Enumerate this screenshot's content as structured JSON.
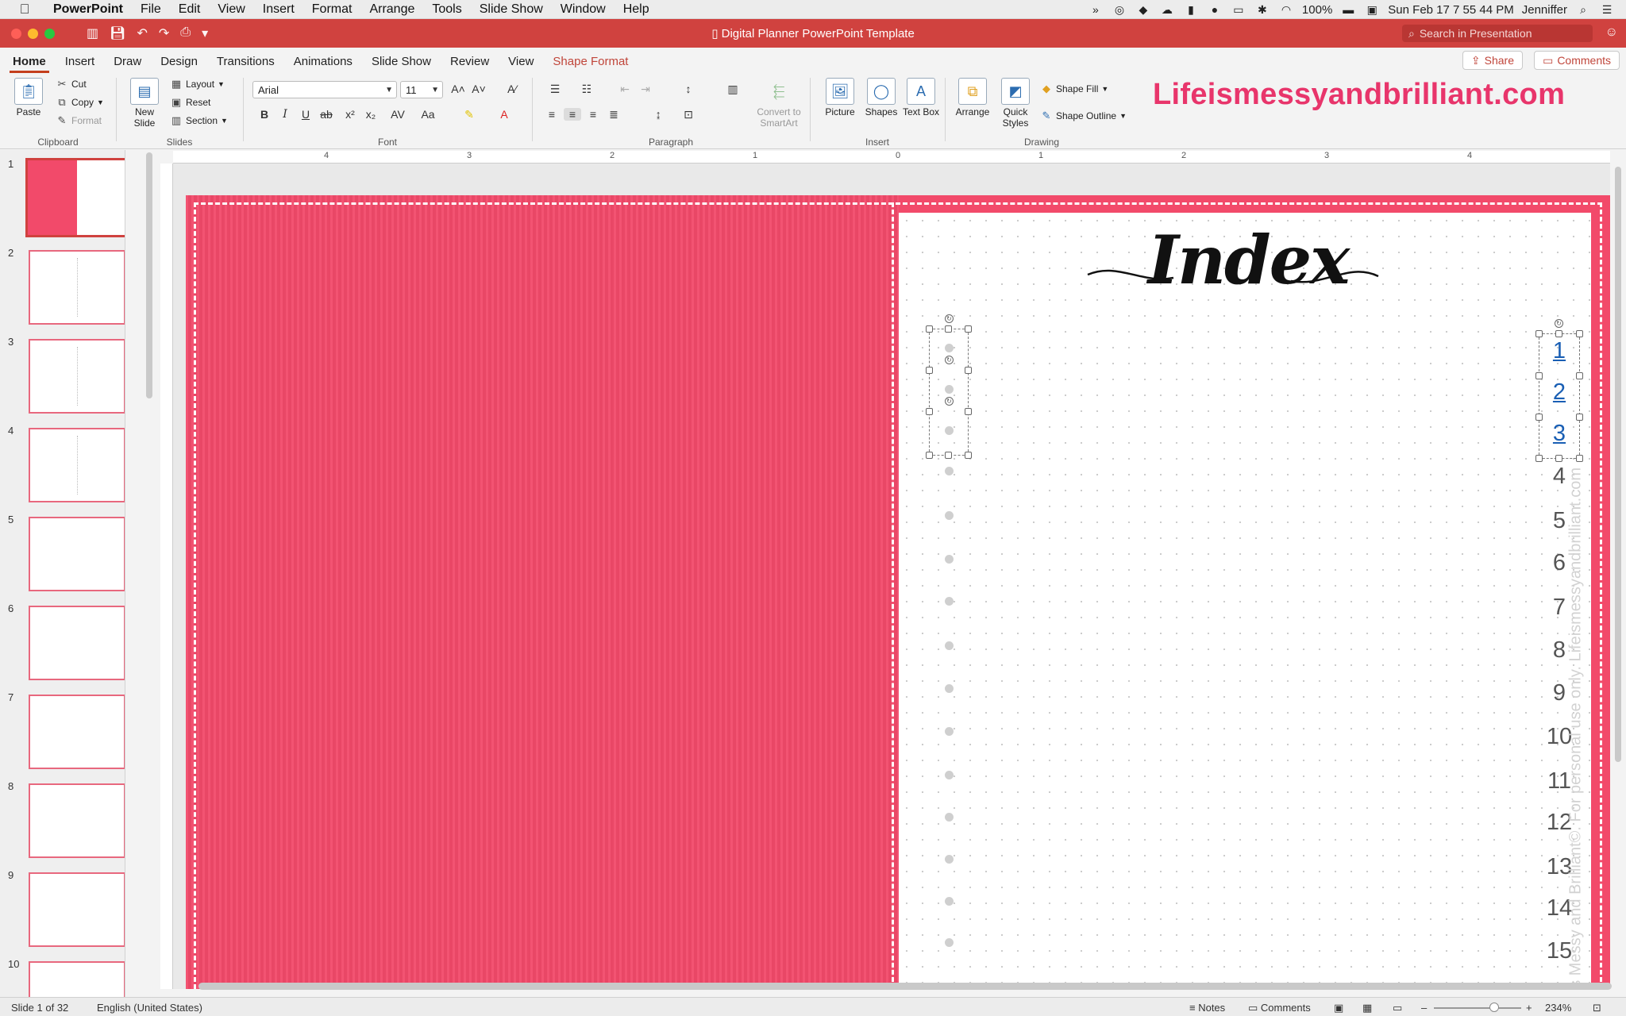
{
  "menubar": {
    "app_name": "PowerPoint",
    "items": [
      "File",
      "Edit",
      "View",
      "Insert",
      "Format",
      "Arrange",
      "Tools",
      "Slide Show",
      "Window",
      "Help"
    ],
    "battery": "100%",
    "datetime": "Sun Feb 17  7 55 44 PM",
    "user": "Jenniffer"
  },
  "window": {
    "title": "Digital Planner PowerPoint Template",
    "search_placeholder": "Search in Presentation"
  },
  "ribbon": {
    "tabs": [
      "Home",
      "Insert",
      "Draw",
      "Design",
      "Transitions",
      "Animations",
      "Slide Show",
      "Review",
      "View",
      "Shape Format"
    ],
    "active_tab": "Home",
    "share_label": "Share",
    "comments_label": "Comments",
    "clipboard": {
      "paste": "Paste",
      "cut": "Cut",
      "copy": "Copy",
      "format": "Format",
      "label": "Clipboard"
    },
    "slides": {
      "new_slide": "New Slide",
      "layout": "Layout",
      "reset": "Reset",
      "section": "Section",
      "label": "Slides"
    },
    "font": {
      "name": "Arial",
      "size": "11",
      "label": "Font"
    },
    "paragraph": {
      "label": "Paragraph",
      "convert": "Convert to SmartArt"
    },
    "insert": {
      "picture": "Picture",
      "shapes": "Shapes",
      "text_box": "Text Box",
      "label": "Insert"
    },
    "drawing": {
      "arrange": "Arrange",
      "quick_styles": "Quick Styles",
      "shape_fill": "Shape Fill",
      "shape_outline": "Shape Outline",
      "label": "Drawing"
    }
  },
  "brand_text": "Lifeismessyandbrilliant.com",
  "ruler": {
    "labels": [
      "4",
      "3",
      "2",
      "1",
      "0",
      "1",
      "2",
      "3",
      "4"
    ]
  },
  "slides_panel": {
    "numbers": [
      "1",
      "2",
      "3",
      "4",
      "5",
      "6",
      "7",
      "8",
      "9",
      "10"
    ]
  },
  "slide": {
    "title": "Index",
    "page_numbers": [
      "1",
      "2",
      "3",
      "4",
      "5",
      "6",
      "7",
      "8",
      "9",
      "10",
      "11",
      "12",
      "13",
      "14",
      "15"
    ],
    "side_note": "Life is Messy and Brilliant©. For personal use only. Lifeismessyandbrilliant.com"
  },
  "status": {
    "slide_info": "Slide 1 of 32",
    "language": "English (United States)",
    "notes": "Notes",
    "comments": "Comments",
    "zoom": "234%"
  },
  "colors": {
    "titlebar": "#d0423f",
    "accent": "#c43e1c",
    "cover": "#f24a6a",
    "brand": "#e8356b"
  }
}
